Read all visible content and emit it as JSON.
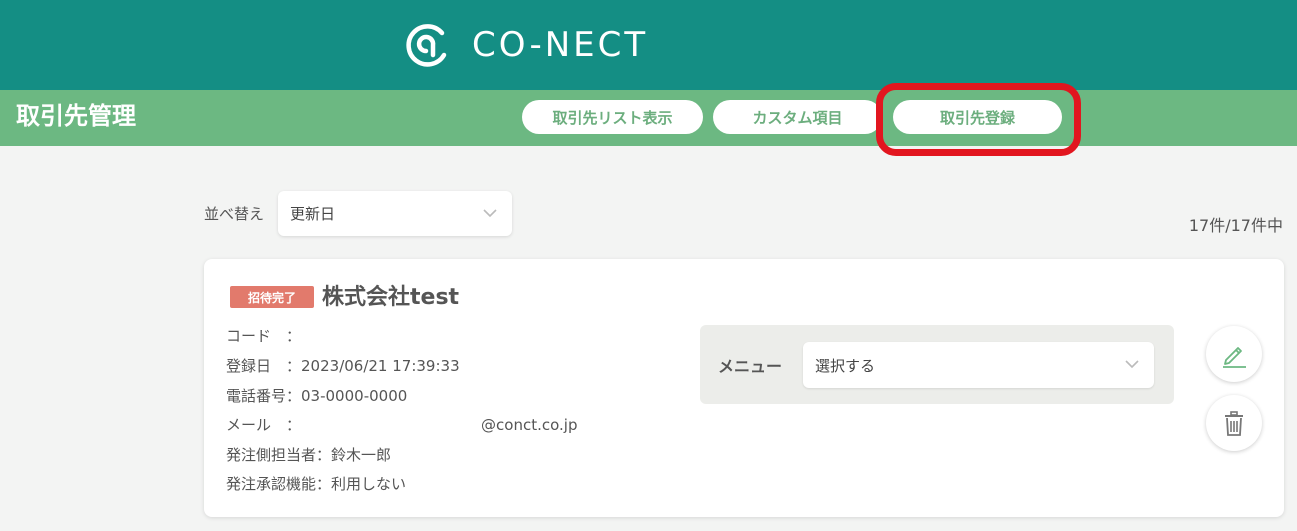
{
  "header": {
    "logo_text": "CO-NECT",
    "logo_icon": "co-nect-logo-mark"
  },
  "subheader": {
    "title": "取引先管理",
    "tabs": [
      {
        "label": "取引先リスト表示"
      },
      {
        "label": "カスタム項目"
      },
      {
        "label": "取引先登録"
      }
    ]
  },
  "sort": {
    "label": "並べ替え",
    "selected": "更新日",
    "icon": "chevron-down-icon"
  },
  "count_text": "17件/17件中",
  "card": {
    "badge": "招待完了",
    "company_name": "株式会社test",
    "fields": [
      {
        "label": "コード　：",
        "value": ""
      },
      {
        "label": "登録日　：",
        "value": "2023/06/21 17:39:33"
      },
      {
        "label": "電話番号：",
        "value": "03-0000-0000"
      },
      {
        "label": "メール　：",
        "value": "@conct.co.jp"
      },
      {
        "label": "発注側担当者：",
        "value": "鈴木一郎"
      },
      {
        "label": "発注承認機能：",
        "value": "利用しない"
      }
    ],
    "menu": {
      "label": "メニュー",
      "selected": "選択する"
    },
    "actions": {
      "edit_icon": "pencil-icon",
      "delete_icon": "trash-icon"
    }
  },
  "colors": {
    "header": "#148e84",
    "subheader": "#6cb882",
    "badge": "#e27a6c",
    "highlight": "#e2161f",
    "accent": "#6cae7e"
  }
}
